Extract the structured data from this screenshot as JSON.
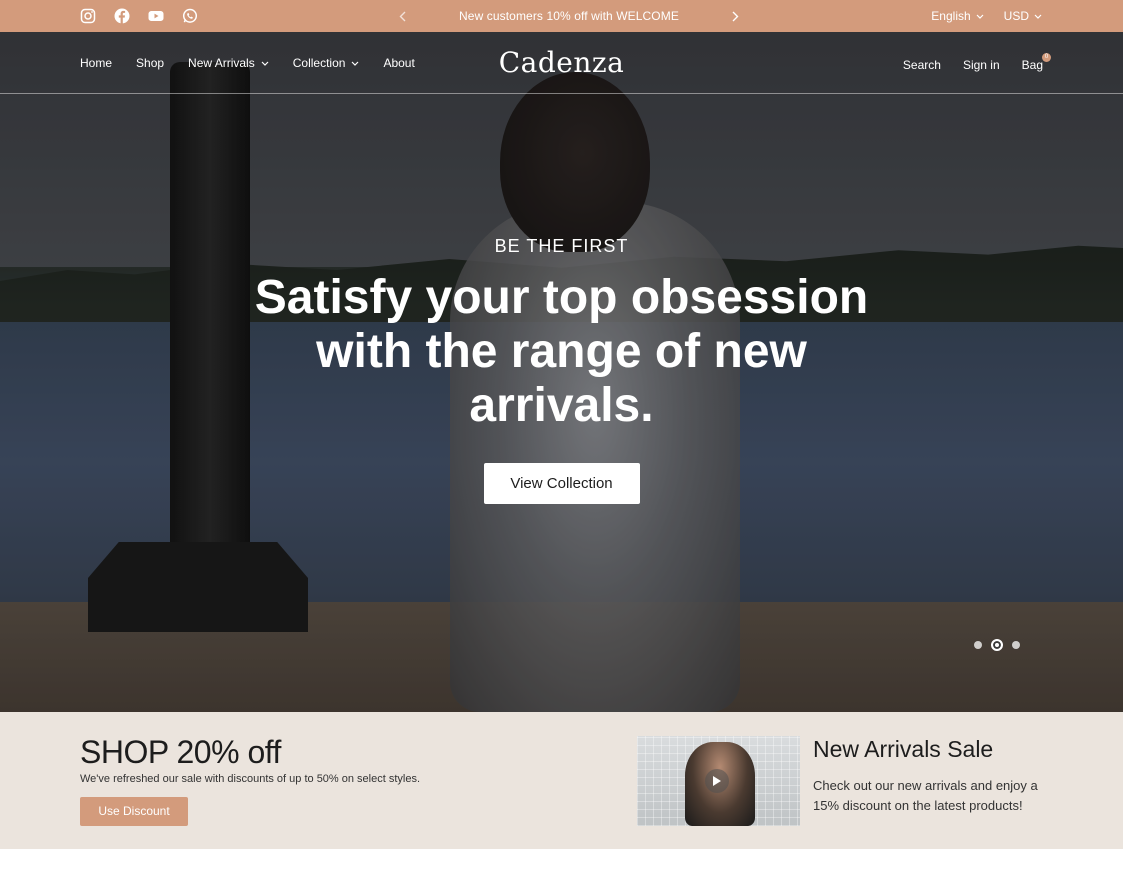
{
  "topbar": {
    "socials": [
      "instagram-icon",
      "facebook-icon",
      "youtube-icon",
      "whatsapp-icon"
    ],
    "announcement": "New customers 10% off with WELCOME",
    "language": "English",
    "currency": "USD"
  },
  "nav": {
    "items": [
      {
        "label": "Home",
        "dropdown": false
      },
      {
        "label": "Shop",
        "dropdown": false
      },
      {
        "label": "New Arrivals",
        "dropdown": true
      },
      {
        "label": "Collection",
        "dropdown": true
      },
      {
        "label": "About",
        "dropdown": false
      }
    ],
    "logo": "Cadenza",
    "search": "Search",
    "sign_in": "Sign in",
    "bag": "Bag",
    "bag_count": "0"
  },
  "hero": {
    "eyebrow": "BE THE FIRST",
    "headline": "Satisfy your top obsession with the range of new arrivals.",
    "cta": "View Collection",
    "slides": 3,
    "active_slide": 2
  },
  "promo": {
    "title": "SHOP 20% off",
    "subtitle": "We've refreshed our sale with discounts of up to 50% on select styles.",
    "button": "Use Discount",
    "card_title": "New Arrivals Sale",
    "card_text": "Check out our new arrivals and enjoy a 15% discount on the latest products!"
  },
  "colors": {
    "accent": "#d39b7c",
    "promo_bg": "#ebe4dd"
  }
}
